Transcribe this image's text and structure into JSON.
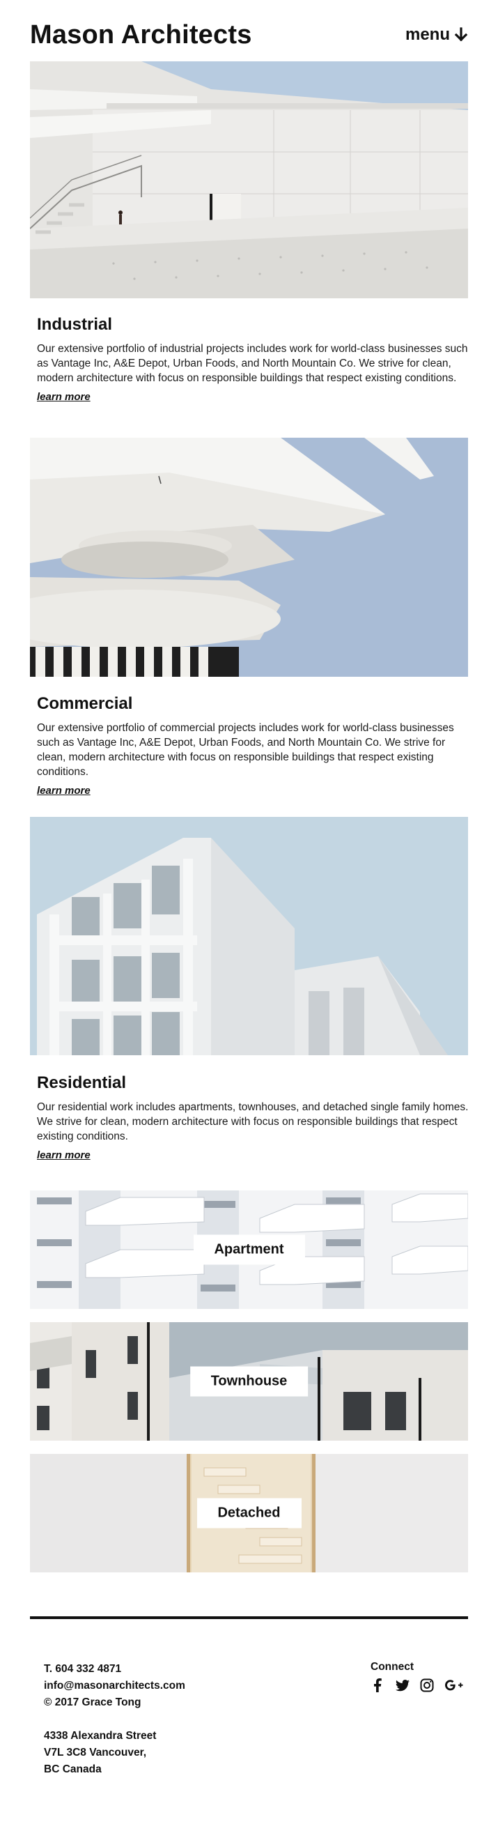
{
  "header": {
    "site_title": "Mason Architects",
    "menu_label": "menu"
  },
  "projects": [
    {
      "title": "Industrial",
      "description": "Our extensive portfolio of industrial projects includes work for world-class businesses such as Vantage Inc, A&E Depot, Urban Foods, and North Mountain Co. We strive for clean, modern architecture with focus on responsible buildings that respect existing conditions.",
      "link_label": "learn more"
    },
    {
      "title": "Commercial",
      "description": "Our extensive portfolio of commercial projects includes work for world-class businesses such as Vantage Inc, A&E Depot, Urban Foods, and North Mountain Co. We strive for clean, modern architecture with focus on responsible buildings that respect existing conditions.",
      "link_label": "learn more"
    },
    {
      "title": "Residential",
      "description": "Our residential work includes apartments, townhouses, and detached single family homes. We strive for clean, modern architecture with focus on responsible buildings that respect existing conditions.",
      "link_label": "learn more"
    }
  ],
  "residential_types": [
    {
      "label": "Apartment"
    },
    {
      "label": "Townhouse"
    },
    {
      "label": "Detached"
    }
  ],
  "footer": {
    "phone": "T. 604 332 4871",
    "email": "info@masonarchitects.com",
    "copyright": "© 2017 Grace Tong",
    "address_line1": "4338 Alexandra Street",
    "address_line2": "V7L 3C8 Vancouver,",
    "address_line3": "BC Canada",
    "connect_label": "Connect",
    "social_icons": [
      "facebook-icon",
      "twitter-icon",
      "instagram-icon",
      "google-plus-icon"
    ]
  },
  "colors": {
    "text": "#111111",
    "sky": "#b9cde2",
    "concrete": "#e9e8e6",
    "background": "#ffffff"
  }
}
